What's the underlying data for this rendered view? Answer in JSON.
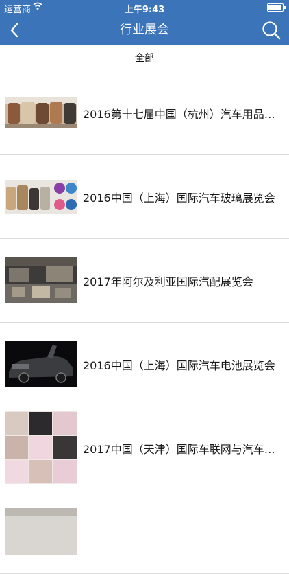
{
  "status_bar": {
    "carrier": "运营商",
    "time": "上午9:43",
    "icons": [
      "wifi-icon",
      "battery-icon"
    ]
  },
  "nav": {
    "title": "行业展会",
    "back_icon": "chevron-left-icon",
    "search_icon": "search-icon"
  },
  "filter": {
    "label": "全部"
  },
  "exhibitions": [
    {
      "title": "2016第十七届中国（杭州）汽车用品展览会"
    },
    {
      "title": "2016中国（上海）国际汽车玻璃展览会"
    },
    {
      "title": "2017年阿尔及利亚国际汽配展览会"
    },
    {
      "title": "2016中国（上海）国际汽车电池展览会"
    },
    {
      "title": "2017中国（天津）国际车联网与汽车电子展览会"
    }
  ],
  "colors": {
    "header": "#3b74b9",
    "divider": "#dcdcdc"
  }
}
